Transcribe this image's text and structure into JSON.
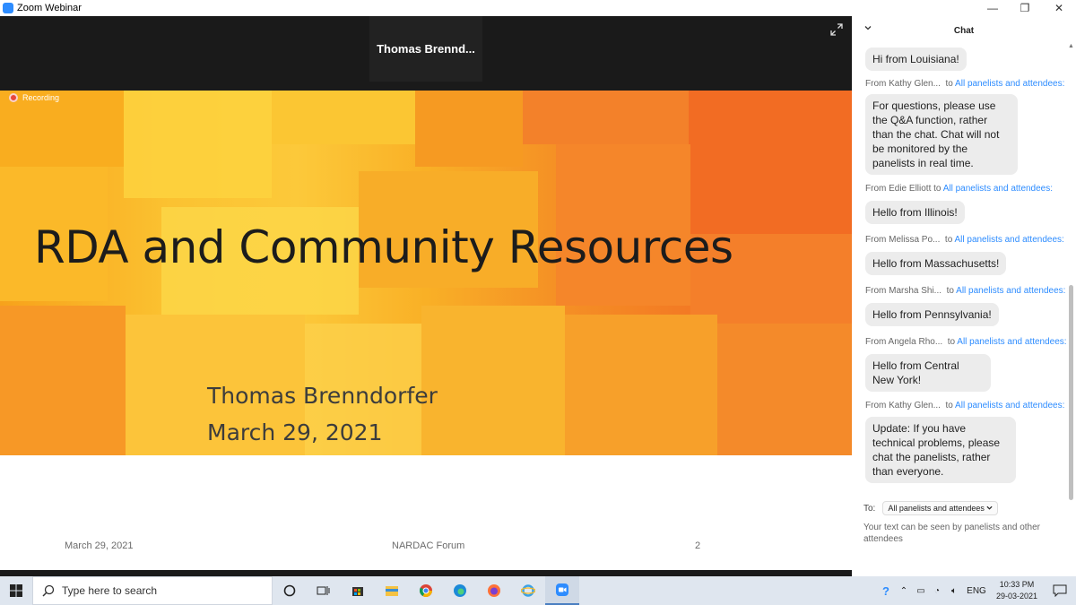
{
  "window": {
    "title": "Zoom Webinar",
    "minimize": "—",
    "maximize": "❐",
    "close": "✕"
  },
  "video": {
    "speaker_name": "Thomas  Brennd...",
    "recording_label": "Recording"
  },
  "slide": {
    "title": "RDA and Community Resources",
    "author": "Thomas Brenndorfer",
    "date": "March 29, 2021",
    "footer_date": "March 29, 2021",
    "footer_center": "NARDAC Forum",
    "footer_page": "2"
  },
  "chat": {
    "header": "Chat",
    "messages": [
      {
        "from": "",
        "to": "",
        "text": "Hi from Louisiana!"
      },
      {
        "from": "From Kathy Glen...",
        "to": "All panelists and attendees:",
        "text": "For questions, please use the Q&A function, rather than the chat. Chat will not be monitored by the panelists in real time."
      },
      {
        "from": "From Edie Elliott",
        "to": "All panelists and attendees:",
        "text": "Hello from Illinois!"
      },
      {
        "from": "From Melissa Po...",
        "to": "All panelists and attendees:",
        "text": "Hello from Massachusetts!"
      },
      {
        "from": "From Marsha Shi...",
        "to": "All panelists and attendees:",
        "text": "Hello from Pennsylvania!"
      },
      {
        "from": "From Angela Rho...",
        "to": "All panelists and attendees:",
        "text": "Hello from Central New York!"
      },
      {
        "from": "From Kathy Glen...",
        "to": "All panelists and attendees:",
        "text": "Update: If you have technical problems, please chat the panelists, rather than everyone."
      }
    ],
    "to_label": "To:",
    "to_value": "All panelists and attendees",
    "note": "Your text can be seen by panelists and other attendees"
  },
  "taskbar": {
    "search_placeholder": "Type here to search",
    "language": "ENG",
    "time": "10:33 PM",
    "date": "29-03-2021"
  },
  "colors": {
    "zoom_blue": "#2D8CFF",
    "link_blue": "#2D8CFF",
    "slide_orange": "#f59125"
  }
}
